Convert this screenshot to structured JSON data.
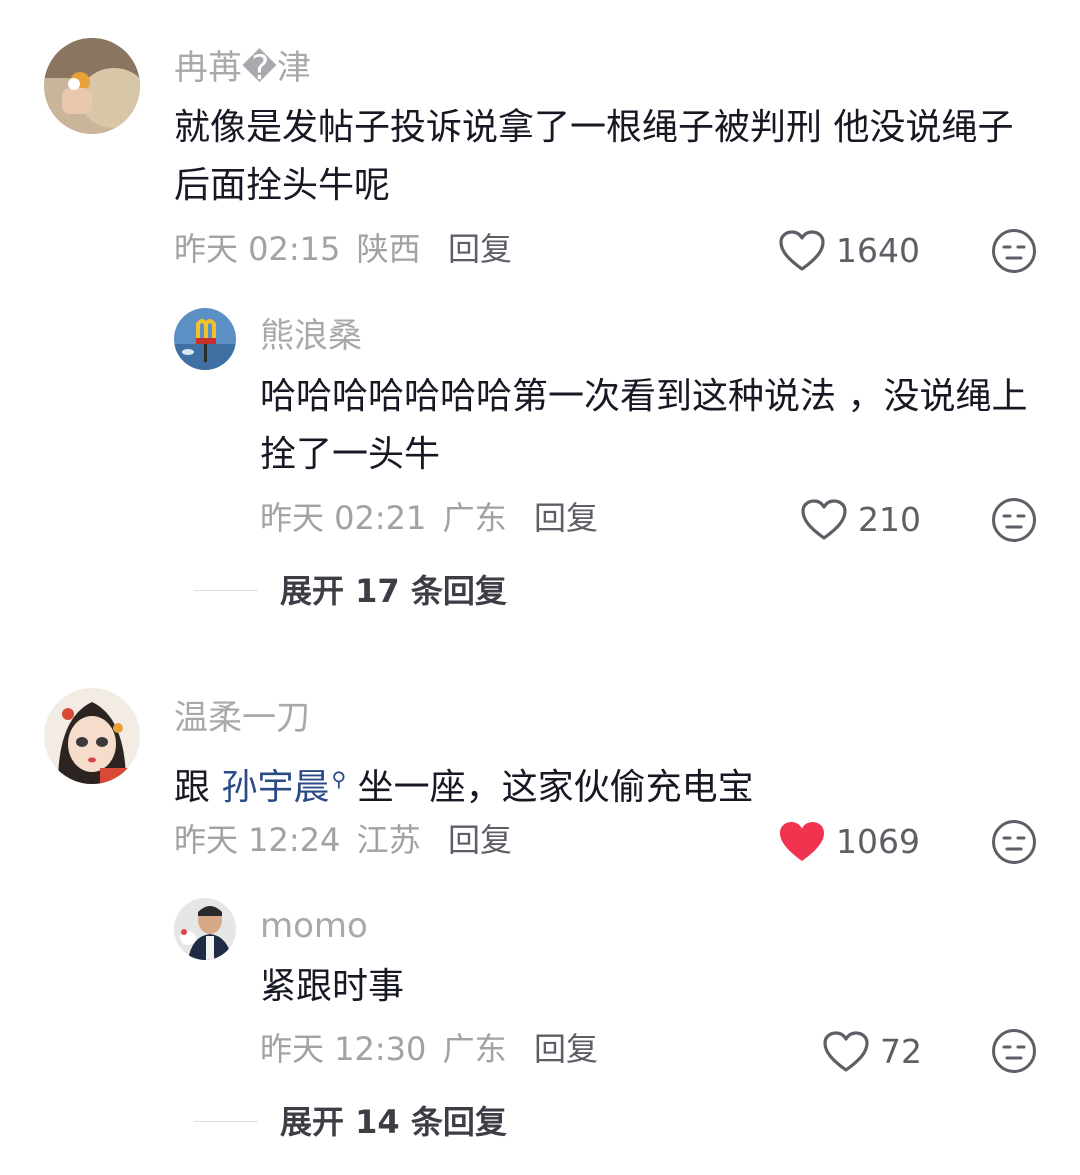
{
  "colors": {
    "liked_heart": "#f0344f",
    "mention": "#2c4b86",
    "meta": "#a1a1a6"
  },
  "comments": [
    {
      "user": "冉苒�津",
      "text": "就像是发帖子投诉说拿了一根绳子被判刑 他没说绳子后面拴头牛呢",
      "time": "昨天 02:15",
      "location": "陕西",
      "reply_label": "回复",
      "likes": "1640",
      "liked": false,
      "replies": [
        {
          "user": "熊浪桑",
          "text": "哈哈哈哈哈哈哈第一次看到这种说法 ，没说绳上拴了一头牛",
          "time": "昨天 02:21",
          "location": "广东",
          "reply_label": "回复",
          "likes": "210",
          "liked": false
        }
      ],
      "expand_label": "展开 17 条回复"
    },
    {
      "user": "温柔一刀",
      "text_prefix": "跟",
      "mention": "孙宇晨",
      "text_suffix": "坐一座，这家伙偷充电宝",
      "time": "昨天 12:24",
      "location": "江苏",
      "reply_label": "回复",
      "likes": "1069",
      "liked": true,
      "replies": [
        {
          "user": "momo",
          "text": "紧跟时事",
          "time": "昨天 12:30",
          "location": "广东",
          "reply_label": "回复",
          "likes": "72",
          "liked": false
        }
      ],
      "expand_label": "展开 14 条回复"
    }
  ]
}
